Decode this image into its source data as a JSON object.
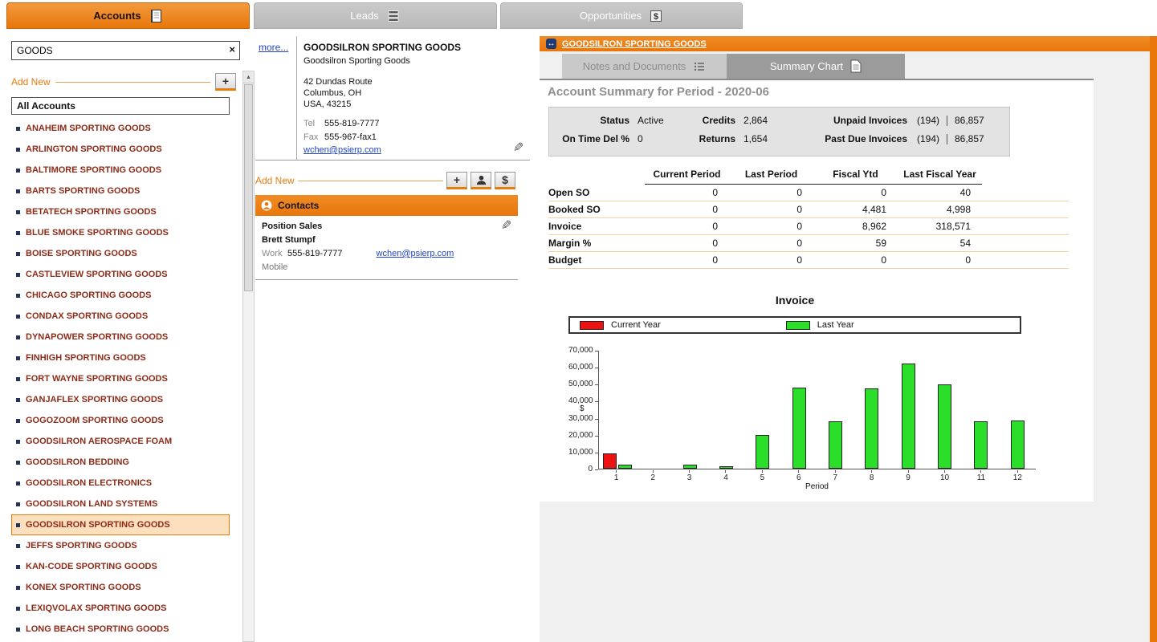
{
  "accent_color": "#E8760B",
  "icons": {
    "clear_search": "×",
    "add_plus": "+",
    "add_dollar": "$",
    "edit_pencil": "✎",
    "breadcrumb_arrows": "↔",
    "scroll_up": "▲"
  },
  "tabs": {
    "accounts": "Accounts",
    "leads": "Leads",
    "opportunities": "Opportunities"
  },
  "sidebar": {
    "search_value": "GOODS",
    "add_new_label": "Add New",
    "list_header": "All Accounts",
    "selected_account": "GOODSILRON SPORTING GOODS",
    "accounts": [
      "ANAHEIM SPORTING GOODS",
      "ARLINGTON SPORTING GOODS",
      "BALTIMORE SPORTING GOODS",
      "BARTS SPORTING GOODS",
      "BETATECH SPORTING GOODS",
      "BLUE SMOKE SPORTING GOODS",
      "BOISE SPORTING GOODS",
      "CASTLEVIEW SPORTING GOODS",
      "CHICAGO SPORTING GOODS",
      "CONDAX SPORTING GOODS",
      "DYNAPOWER SPORTING GOODS",
      "FINHIGH SPORTING GOODS",
      "FORT WAYNE SPORTING GOODS",
      "GANJAFLEX SPORTING GOODS",
      "GOGOZOOM SPORTING GOODS",
      "GOODSILRON AEROSPACE FOAM",
      "GOODSILRON BEDDING",
      "GOODSILRON ELECTRONICS",
      "GOODSILRON LAND SYSTEMS",
      "GOODSILRON SPORTING GOODS",
      "JEFFS SPORTING GOODS",
      "KAN-CODE SPORTING GOODS",
      "KONEX SPORTING GOODS",
      "LEXIQVOLAX SPORTING GOODS",
      "LONG BEACH SPORTING GOODS"
    ]
  },
  "detail": {
    "more_link": "more...",
    "name": "GOODSILRON SPORTING GOODS",
    "subtitle": "Goodsilron Sporting Goods",
    "address1": "42 Dundas Route",
    "address2": "Columbus, OH",
    "address3": "USA, 43215",
    "tel_label": "Tel",
    "tel": "555-819-7777",
    "fax_label": "Fax",
    "fax": "555-967-fax1",
    "email": "wchen@psierp.com",
    "add_new_label": "Add New"
  },
  "contacts": {
    "header": "Contacts",
    "position": "Position Sales",
    "name": "Brett Stumpf",
    "work_label": "Work",
    "work_phone": "555-819-7777",
    "email": "wchen@psierp.com",
    "mobile_label": "Mobile"
  },
  "main": {
    "breadcrumb": "GOODSILRON SPORTING GOODS",
    "tab_notes": "Notes and Documents",
    "tab_summary": "Summary Chart",
    "heading": "Account Summary for Period - 2020-06",
    "status": {
      "status_label": "Status",
      "status_value": "Active",
      "ontime_label": "On Time Del %",
      "ontime_value": "0",
      "credits_label": "Credits",
      "credits_value": "2,864",
      "returns_label": "Returns",
      "returns_value": "1,654",
      "unpaid_label": "Unpaid Invoices",
      "unpaid_count": "(194)",
      "unpaid_value": "86,857",
      "pastdue_label": "Past Due Invoices",
      "pastdue_count": "(194)",
      "pastdue_value": "86,857"
    },
    "summary_table": {
      "columns": [
        "Current Period",
        "Last Period",
        "Fiscal Ytd",
        "Last Fiscal Year"
      ],
      "rows": [
        {
          "label": "Open SO",
          "values": [
            "0",
            "0",
            "0",
            "40"
          ]
        },
        {
          "label": "Booked SO",
          "values": [
            "0",
            "0",
            "4,481",
            "4,998"
          ]
        },
        {
          "label": "Invoice",
          "values": [
            "0",
            "0",
            "8,962",
            "318,571"
          ]
        },
        {
          "label": "Margin %",
          "values": [
            "0",
            "0",
            "59",
            "54"
          ]
        },
        {
          "label": "Budget",
          "values": [
            "0",
            "0",
            "0",
            "0"
          ]
        }
      ]
    }
  },
  "chart_data": {
    "type": "bar",
    "title": "Invoice",
    "xlabel": "Period",
    "ylabel": "$",
    "ylim": [
      0,
      70000
    ],
    "ytick_step": 10000,
    "grid": false,
    "legend_position": "top",
    "categories": [
      "1",
      "2",
      "3",
      "4",
      "5",
      "6",
      "7",
      "8",
      "9",
      "10",
      "11",
      "12"
    ],
    "series": [
      {
        "name": "Current Year",
        "color": "#EE1111",
        "values": [
          8962,
          0,
          0,
          0,
          0,
          0,
          0,
          0,
          0,
          0,
          0,
          0
        ]
      },
      {
        "name": "Last Year",
        "color": "#2ADE2A",
        "values": [
          2500,
          0,
          2600,
          1400,
          20000,
          48000,
          28000,
          47500,
          62000,
          49500,
          28000,
          28500
        ]
      }
    ]
  }
}
